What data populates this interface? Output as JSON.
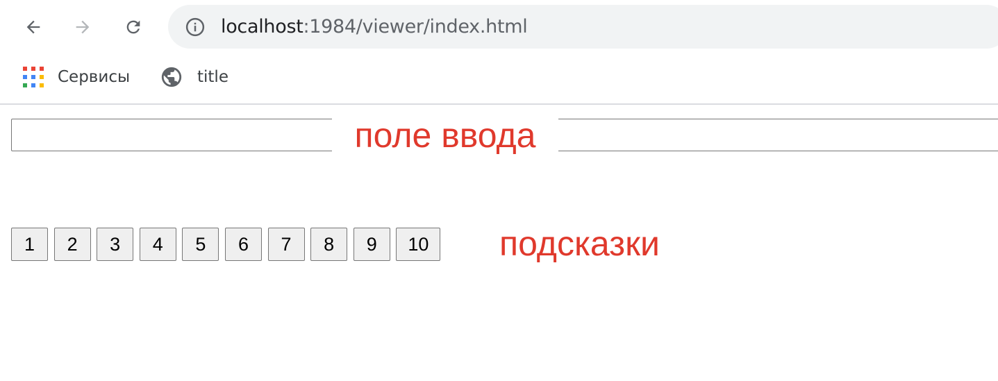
{
  "browser": {
    "url_host": "localhost",
    "url_path": ":1984/viewer/index.html",
    "nav": {
      "back_icon": "arrow-left-icon",
      "forward_icon": "arrow-right-icon",
      "reload_icon": "reload-icon",
      "info_icon": "info-icon"
    }
  },
  "bookmarks": [
    {
      "label": "Сервисы",
      "icon": "apps-grid-icon"
    },
    {
      "label": "title",
      "icon": "globe-icon"
    }
  ],
  "page": {
    "input": {
      "value": "",
      "placeholder": ""
    },
    "hints": [
      "1",
      "2",
      "3",
      "4",
      "5",
      "6",
      "7",
      "8",
      "9",
      "10"
    ]
  },
  "annotations": {
    "input_label": "поле ввода",
    "hints_label": "подсказки"
  },
  "colors": {
    "annotation": "#e0392c",
    "omnibox_bg": "#f1f3f4",
    "button_bg": "#efefef"
  }
}
